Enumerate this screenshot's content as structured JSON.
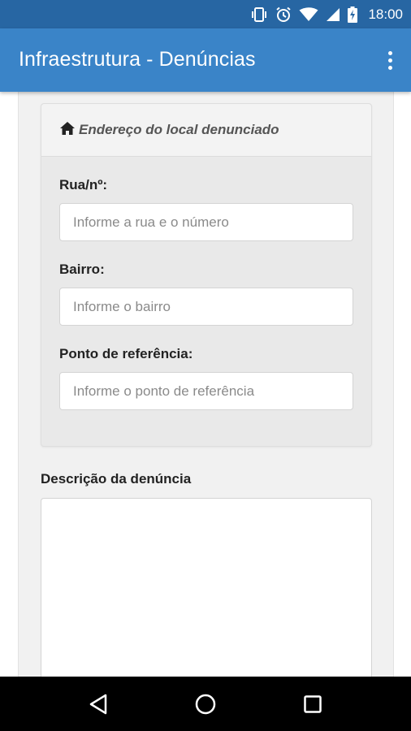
{
  "status_bar": {
    "time": "18:00",
    "icons": [
      "vibrate-icon",
      "alarm-icon",
      "wifi-icon",
      "signal-icon",
      "battery-charging-icon"
    ]
  },
  "app_bar": {
    "title": "Infraestrutura - Denúncias",
    "overflow_icon": "more-vert-icon"
  },
  "address_section": {
    "header_icon": "home-icon",
    "header_title": "Endereço do local denunciado",
    "fields": [
      {
        "label": "Rua/nº:",
        "value": "",
        "placeholder": "Informe a rua e o número"
      },
      {
        "label": "Bairro:",
        "value": "",
        "placeholder": "Informe o bairro"
      },
      {
        "label": "Ponto de referência:",
        "value": "",
        "placeholder": "Informe o ponto de referência"
      }
    ]
  },
  "description": {
    "label": "Descrição da denúncia",
    "value": ""
  },
  "nav_bar": {
    "icons": [
      "back-icon",
      "home-circle-icon",
      "recents-icon"
    ]
  },
  "colors": {
    "status_bar": "#2766a3",
    "app_bar": "#3a84c8",
    "panel_bg": "#f1f1f1",
    "card_bg": "#e9e9e9"
  }
}
